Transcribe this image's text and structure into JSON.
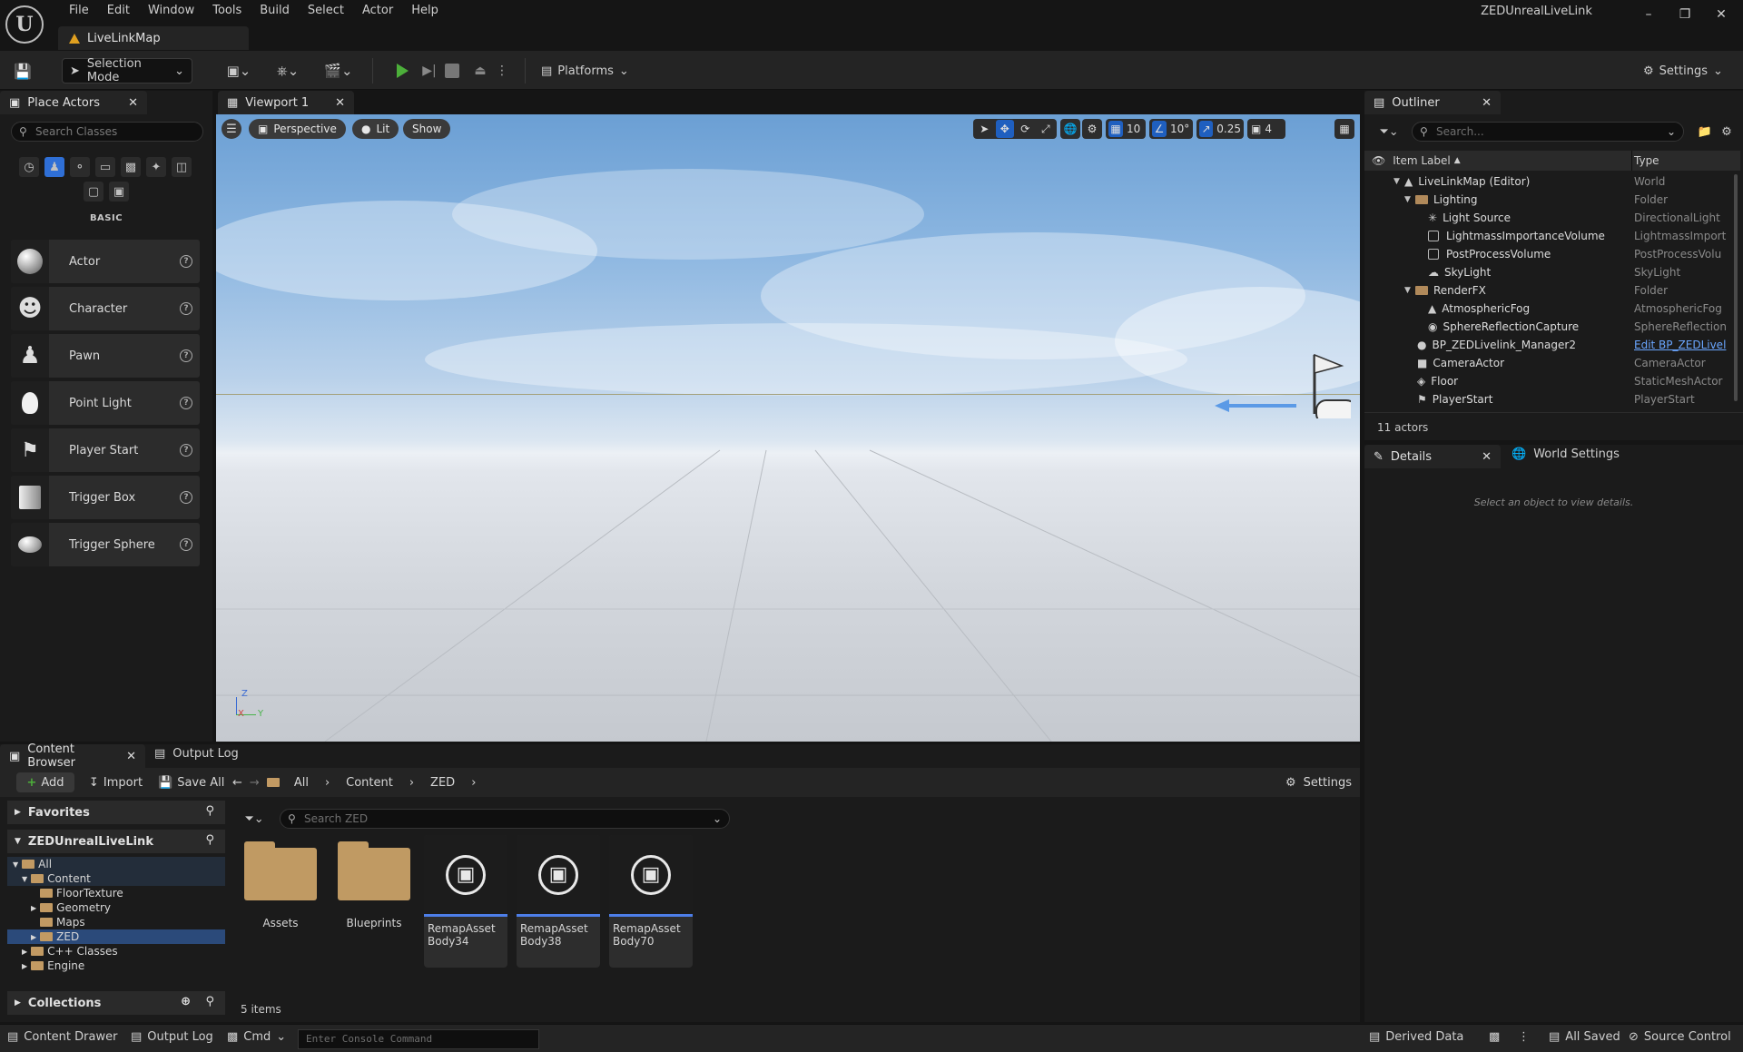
{
  "menu": [
    "File",
    "Edit",
    "Window",
    "Tools",
    "Build",
    "Select",
    "Actor",
    "Help"
  ],
  "map_tab": "LiveLinkMap",
  "project_title": "ZEDUnrealLiveLink",
  "toolbar": {
    "selection_mode": "Selection Mode",
    "platforms": "Platforms",
    "settings": "Settings"
  },
  "place_actors": {
    "tab": "Place Actors",
    "search_placeholder": "Search Classes",
    "section": "BASIC",
    "items": [
      "Actor",
      "Character",
      "Pawn",
      "Point Light",
      "Player Start",
      "Trigger Box",
      "Trigger Sphere"
    ]
  },
  "viewport": {
    "tab": "Viewport 1",
    "perspective": "Perspective",
    "lit": "Lit",
    "show": "Show",
    "grid_snap": "10",
    "rot_snap": "10°",
    "scale_snap": "0.25",
    "camera_speed": "4",
    "axis_z": "Z",
    "axis_x": "X",
    "axis_y": "Y"
  },
  "outliner": {
    "tab": "Outliner",
    "search_placeholder": "Search...",
    "col_label": "Item Label",
    "col_type": "Type",
    "rows": [
      {
        "label": "LiveLinkMap (Editor)",
        "type": "World"
      },
      {
        "label": "Lighting",
        "type": "Folder"
      },
      {
        "label": "Light Source",
        "type": "DirectionalLight"
      },
      {
        "label": "LightmassImportanceVolume",
        "type": "LightmassImport"
      },
      {
        "label": "PostProcessVolume",
        "type": "PostProcessVolu"
      },
      {
        "label": "SkyLight",
        "type": "SkyLight"
      },
      {
        "label": "RenderFX",
        "type": "Folder"
      },
      {
        "label": "AtmosphericFog",
        "type": "AtmosphericFog"
      },
      {
        "label": "SphereReflectionCapture",
        "type": "SphereReflection"
      },
      {
        "label": "BP_ZEDLivelink_Manager2",
        "type": "Edit BP_ZEDLivel"
      },
      {
        "label": "CameraActor",
        "type": "CameraActor"
      },
      {
        "label": "Floor",
        "type": "StaticMeshActor"
      },
      {
        "label": "PlayerStart",
        "type": "PlayerStart"
      }
    ],
    "count": "11 actors"
  },
  "details": {
    "tab": "Details",
    "world_tab": "World Settings",
    "empty": "Select an object to view details."
  },
  "content_browser": {
    "tab": "Content Browser",
    "output_log_tab": "Output Log",
    "add": "Add",
    "import": "Import",
    "save_all": "Save All",
    "breadcrumb": [
      "All",
      "Content",
      "ZED"
    ],
    "settings": "Settings",
    "favorites": "Favorites",
    "project": "ZEDUnrealLiveLink",
    "tree": [
      "All",
      "Content",
      "FloorTexture",
      "Geometry",
      "Maps",
      "ZED",
      "C++ Classes",
      "Engine"
    ],
    "collections": "Collections",
    "search_placeholder": "Search ZED",
    "folders": [
      "Assets",
      "Blueprints"
    ],
    "assets": [
      {
        "line1": "RemapAsset",
        "line2": "Body34"
      },
      {
        "line1": "RemapAsset",
        "line2": "Body38"
      },
      {
        "line1": "RemapAsset",
        "line2": "Body70"
      }
    ],
    "count": "5 items"
  },
  "statusbar": {
    "content_drawer": "Content Drawer",
    "output_log": "Output Log",
    "cmd": "Cmd",
    "console_placeholder": "Enter Console Command",
    "derived_data": "Derived Data",
    "all_saved": "All Saved",
    "source_control": "Source Control"
  },
  "colors": {
    "accent": "#2f6fd6",
    "play": "#4caf3a",
    "folder": "#c09a63"
  }
}
